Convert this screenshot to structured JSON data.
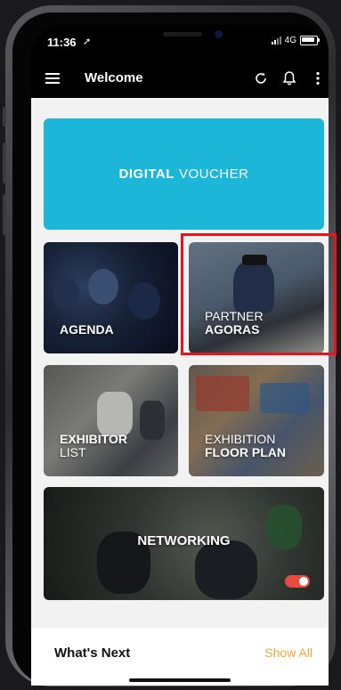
{
  "status_bar": {
    "time": "11:36",
    "location_arrow": "➚",
    "network": "4G"
  },
  "header": {
    "title": "Welcome",
    "menu_icon": "hamburger-icon",
    "refresh_icon": "refresh-icon",
    "bell_icon": "bell-icon",
    "more_icon": "more-vertical-icon"
  },
  "tiles": {
    "voucher": {
      "bold": "DIGITAL",
      "light": "VOUCHER",
      "bg": "#1bb6d8"
    },
    "agenda": {
      "bold": "AGENDA"
    },
    "agoras": {
      "light": "PARTNER",
      "bold": "AGORAS"
    },
    "exhibitor": {
      "bold": "EXHIBITOR",
      "light": "LIST"
    },
    "floor": {
      "light": "EXHIBITION",
      "bold": "FLOOR PLAN"
    },
    "networking": {
      "bold": "NETWORKING"
    }
  },
  "whats_next": {
    "title": "What's Next",
    "link": "Show All",
    "link_color": "#f0a63a"
  },
  "highlight_color": "#e8141b"
}
